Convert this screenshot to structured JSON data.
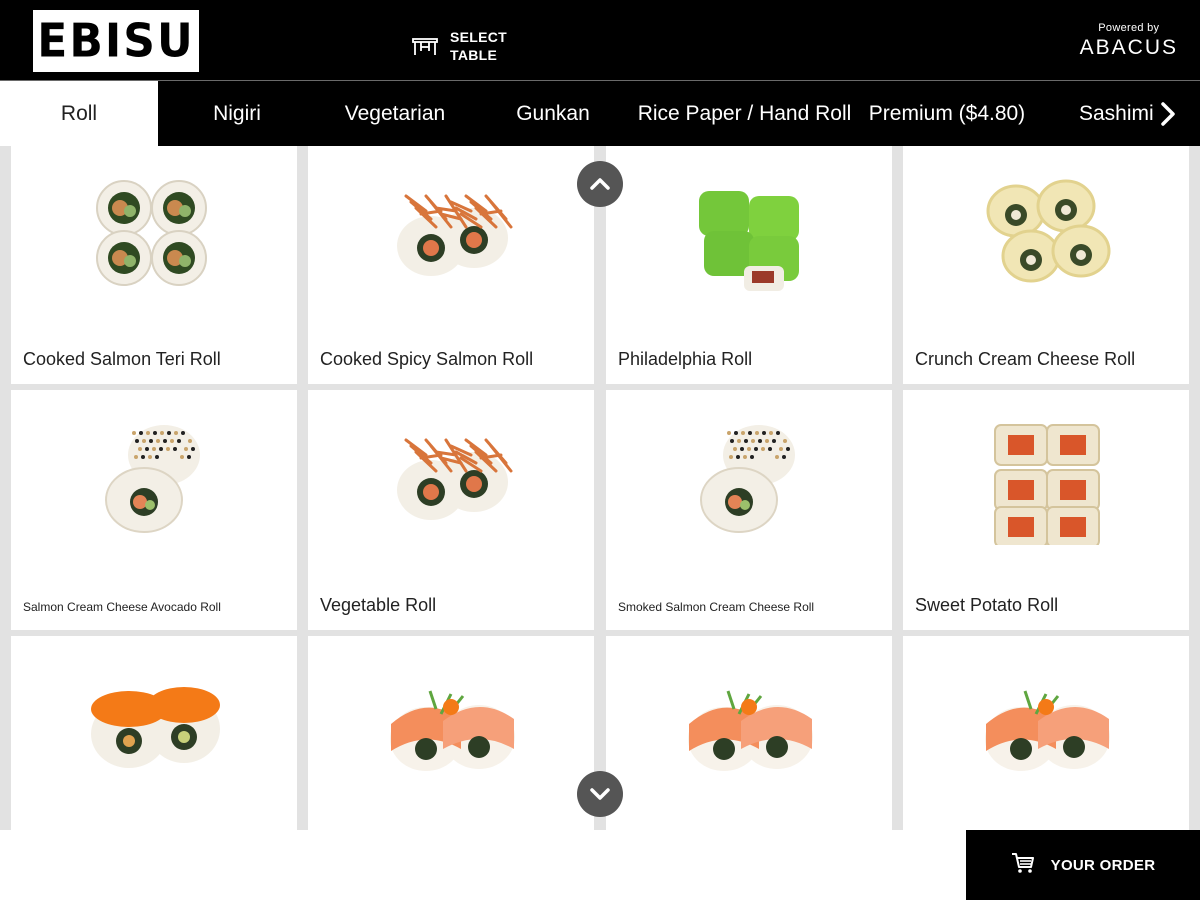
{
  "header": {
    "logo_text": "EBISU",
    "select_table_line1": "SELECT",
    "select_table_line2": "TABLE",
    "powered_by": "Powered by",
    "powered_brand": "ABACUS"
  },
  "tabs": [
    {
      "label": "Roll",
      "active": true
    },
    {
      "label": "Nigiri",
      "active": false
    },
    {
      "label": "Vegetarian",
      "active": false
    },
    {
      "label": "Gunkan",
      "active": false
    },
    {
      "label": "Rice Paper / Hand Roll",
      "active": false
    },
    {
      "label": "Premium ($4.80)",
      "active": false
    },
    {
      "label": "Sashimi",
      "active": false
    }
  ],
  "menu_items": [
    {
      "name": "Cooked Salmon Teri Roll",
      "style": "teri"
    },
    {
      "name": "Cooked Spicy Salmon Roll",
      "style": "crispy"
    },
    {
      "name": "Philadelphia Roll",
      "style": "tobiko-green"
    },
    {
      "name": "Crunch Cream Cheese Roll",
      "style": "crunch"
    },
    {
      "name": "Salmon Cream Cheese Avocado Roll",
      "style": "sesame"
    },
    {
      "name": "Vegetable Roll",
      "style": "crispy"
    },
    {
      "name": "Smoked Salmon Cream Cheese Roll",
      "style": "sesame"
    },
    {
      "name": "Sweet Potato Roll",
      "style": "sweet-potato"
    },
    {
      "name": "",
      "style": "tobiko-orange"
    },
    {
      "name": "",
      "style": "salmon-top"
    },
    {
      "name": "",
      "style": "salmon-top"
    },
    {
      "name": "",
      "style": "salmon-top"
    }
  ],
  "footer": {
    "order_label": "YOUR ORDER"
  },
  "icons": {
    "table": "table-icon",
    "next": "chevron-right-icon",
    "up": "chevron-up-icon",
    "down": "chevron-down-icon",
    "cart": "cart-icon"
  }
}
